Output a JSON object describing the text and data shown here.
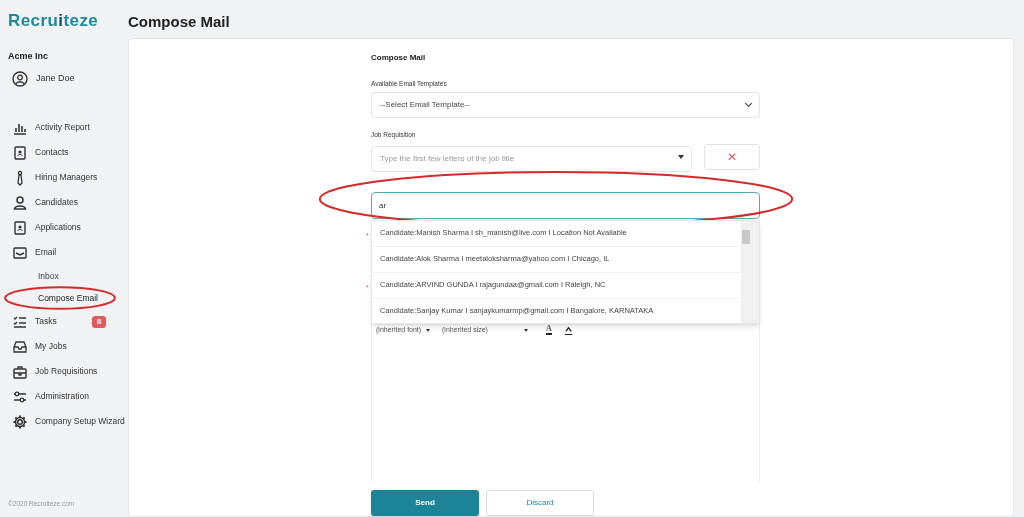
{
  "sidebar": {
    "logo": {
      "before": "Recru",
      "accent": "i",
      "after": "teze"
    },
    "company": "Acme Inc",
    "user": "Jane Doe",
    "items": [
      {
        "label": "Activity Report",
        "selected": false
      },
      {
        "label": "Contacts",
        "selected": false
      },
      {
        "label": "Hiring Managers",
        "selected": false
      },
      {
        "label": "Candidates",
        "selected": false
      },
      {
        "label": "Applications",
        "selected": false
      },
      {
        "label": "Email",
        "selected": false,
        "children": [
          {
            "label": "Inbox",
            "selected": false,
            "circled": false
          },
          {
            "label": "Compose Email",
            "selected": true,
            "circled": true
          }
        ]
      },
      {
        "label": "Tasks",
        "selected": false,
        "badge": "8"
      },
      {
        "label": "My Jobs",
        "selected": false
      },
      {
        "label": "Job Requisitions",
        "selected": false
      },
      {
        "label": "Administration",
        "selected": false
      },
      {
        "label": "Company Setup Wizard",
        "selected": false
      }
    ],
    "footer": "©2020 Recruiteze.com"
  },
  "page_title": "Compose Mail",
  "form": {
    "title": "Compose Mail",
    "template": {
      "label": "Available Email Templates",
      "value": "--Select Email Template--"
    },
    "job_requisition": {
      "label": "Job Requisition",
      "placeholder": "Type the first few letters of the job title",
      "clear": "✕"
    },
    "to": {
      "value": "ar",
      "circled": true
    },
    "suggestions": [
      "Candidate:Manish Sharma I sh_manish@live.com I Location Not Available",
      "Candidate:Alok Sharma I meetaloksharma@yahoo.com I Chicago, IL",
      "Candidate:ARVIND GUNDA I rajagundaa@gmail.com I Raleigh, NC",
      "Candidate:Sanjay Kumar I sanjaykumarmp@gmail.com I Bangalore, KARNATAKA"
    ],
    "required_marks": [
      "*",
      "*"
    ],
    "toolbar": {
      "font": "(inherited font)",
      "size": "(inherited size)",
      "text_color": "A"
    },
    "buttons": [
      {
        "label": "Send",
        "kind": "primary"
      },
      {
        "label": "Discard",
        "kind": "secondary"
      }
    ]
  }
}
